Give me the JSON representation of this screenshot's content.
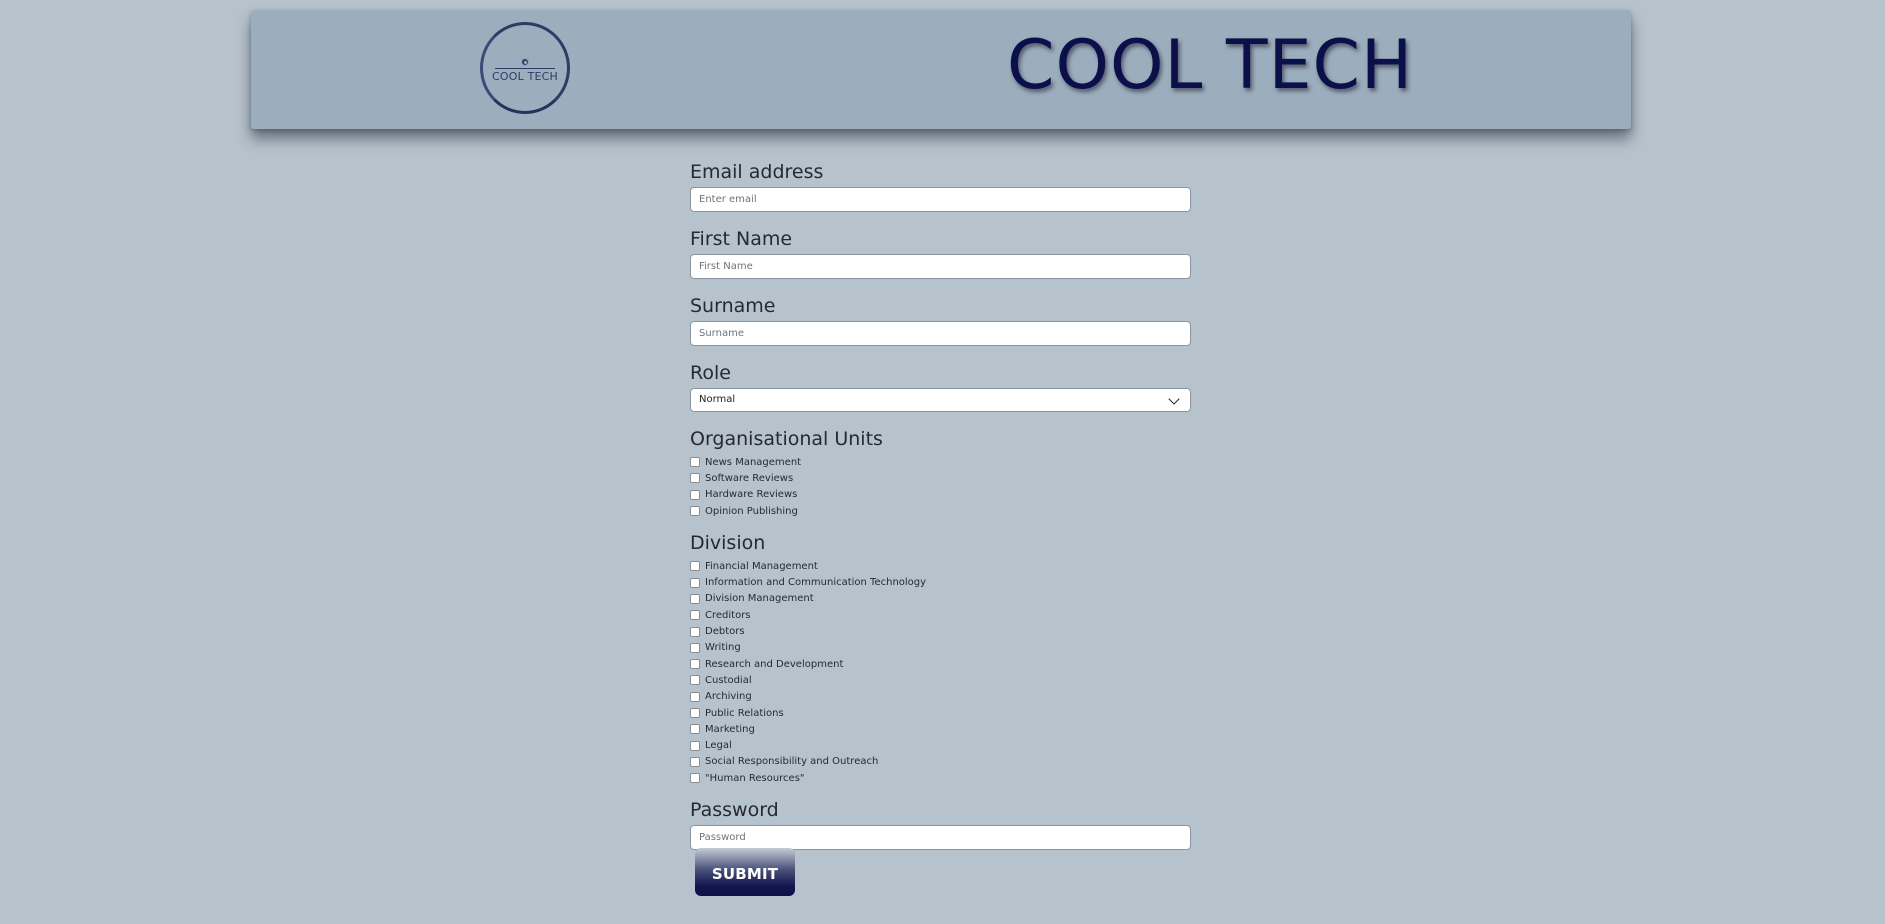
{
  "header": {
    "logo_text": "COOL TECH",
    "brand_title": "COOL TECH"
  },
  "form": {
    "email": {
      "label": "Email address",
      "placeholder": "Enter email"
    },
    "first_name": {
      "label": "First Name",
      "placeholder": "First Name"
    },
    "surname": {
      "label": "Surname",
      "placeholder": "Surname"
    },
    "role": {
      "label": "Role",
      "selected": "Normal"
    },
    "org_units": {
      "label": "Organisational Units",
      "options": [
        "News Management",
        "Software Reviews",
        "Hardware Reviews",
        "Opinion Publishing"
      ]
    },
    "division": {
      "label": "Division",
      "options": [
        "Financial Management",
        "Information and Communication Technology",
        "Division Management",
        "Creditors",
        "Debtors",
        "Writing",
        "Research and Development",
        "Custodial",
        "Archiving",
        "Public Relations",
        "Marketing",
        "Legal",
        "Social Responsibility and Outreach",
        "\"Human Resources\""
      ]
    },
    "password": {
      "label": "Password",
      "placeholder": "Password"
    },
    "submit_label": "SUBMIT"
  },
  "colors": {
    "background": "#b7c3cc",
    "header_bg": "#9caebd",
    "brand": "#0d0f4a",
    "button_dark": "#12164e"
  }
}
